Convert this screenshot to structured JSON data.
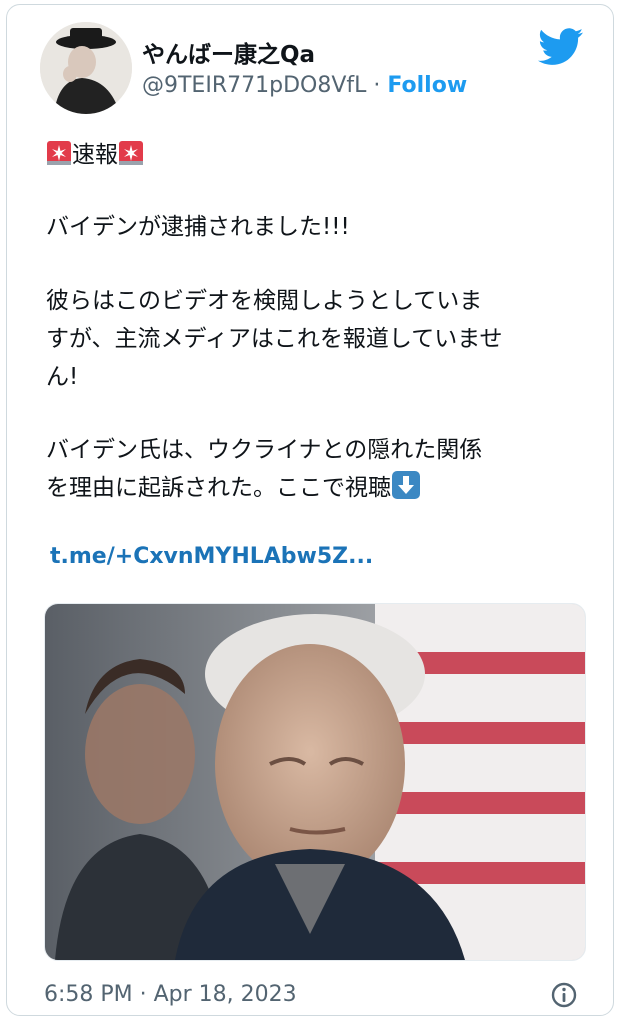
{
  "user": {
    "display_name": "やんばー康之Qa",
    "handle": "@9TEIR771pDO8VfL",
    "separator": "·",
    "follow_label": "Follow"
  },
  "tweet": {
    "headline": "速報",
    "lines": [
      "バイデンが逮捕されました!!!",
      "彼らはこのビデオを検閲しようとしていま",
      "すが、主流メディアはこれを報道していませ",
      "ん!",
      "バイデン氏は、ウクライナとの隠れた関係",
      "を理由に起訴された。ここで視聴"
    ],
    "link_text": "t.me/+CxvnMYHLAbw5Z..."
  },
  "footer": {
    "timestamp": "6:58 PM · Apr 18, 2023"
  },
  "icons": {
    "logo": "twitter-bird-icon",
    "headline_emoji": "siren-icon",
    "watch_emoji": "down-arrow-icon",
    "info": "info-icon"
  },
  "colors": {
    "accent": "#1d9bf0",
    "link": "#1b73b7",
    "secondary_text": "#536471",
    "border": "#cfd9de"
  }
}
